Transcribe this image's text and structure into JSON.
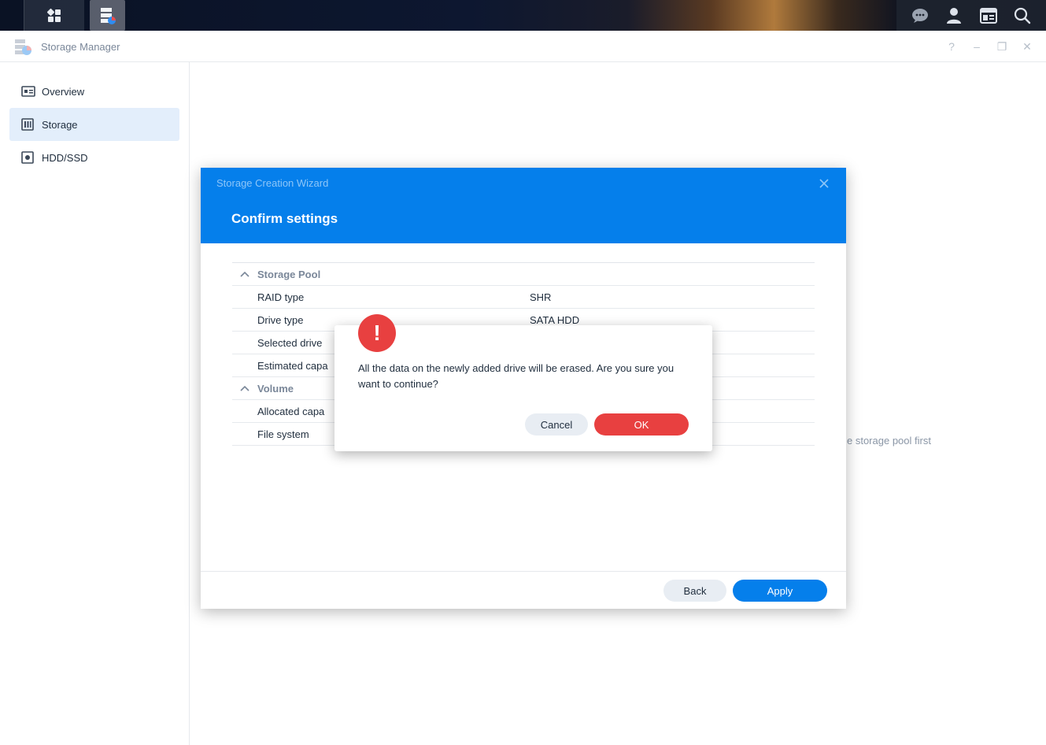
{
  "taskbar": {
    "apps_icon": "main-menu-grid-icon",
    "active_app_icon": "storage-manager-icon",
    "right_icons": [
      "chat-icon",
      "user-icon",
      "widgets-icon",
      "search-icon"
    ]
  },
  "window": {
    "title": "Storage Manager",
    "controls": [
      "?",
      "–",
      "❐",
      "✕"
    ]
  },
  "sidebar": {
    "items": [
      {
        "label": "Overview",
        "icon": "overview-icon",
        "active": false
      },
      {
        "label": "Storage",
        "icon": "storage-icon",
        "active": true
      },
      {
        "label": "HDD/SSD",
        "icon": "hdd-icon",
        "active": false
      }
    ]
  },
  "background_hint": "e storage pool first",
  "wizard": {
    "window_title": "Storage Creation Wizard",
    "heading": "Confirm settings",
    "sections": [
      {
        "title": "Storage Pool",
        "rows": [
          {
            "label": "RAID type",
            "value": "SHR"
          },
          {
            "label": "Drive type",
            "value": "SATA HDD"
          },
          {
            "label": "Selected drive",
            "value": ""
          },
          {
            "label": "Estimated capa",
            "value": ""
          }
        ]
      },
      {
        "title": "Volume",
        "rows": [
          {
            "label": "Allocated capa",
            "value": ""
          },
          {
            "label": "File system",
            "value": ""
          }
        ]
      }
    ],
    "back_label": "Back",
    "apply_label": "Apply"
  },
  "confirm_dialog": {
    "icon": "!",
    "message": "All the data on the newly added drive will be erased. Are you sure you want to continue?",
    "cancel_label": "Cancel",
    "ok_label": "OK"
  },
  "colors": {
    "accent": "#057feb",
    "danger": "#e84040",
    "sidebar_active": "#e3eefb"
  }
}
